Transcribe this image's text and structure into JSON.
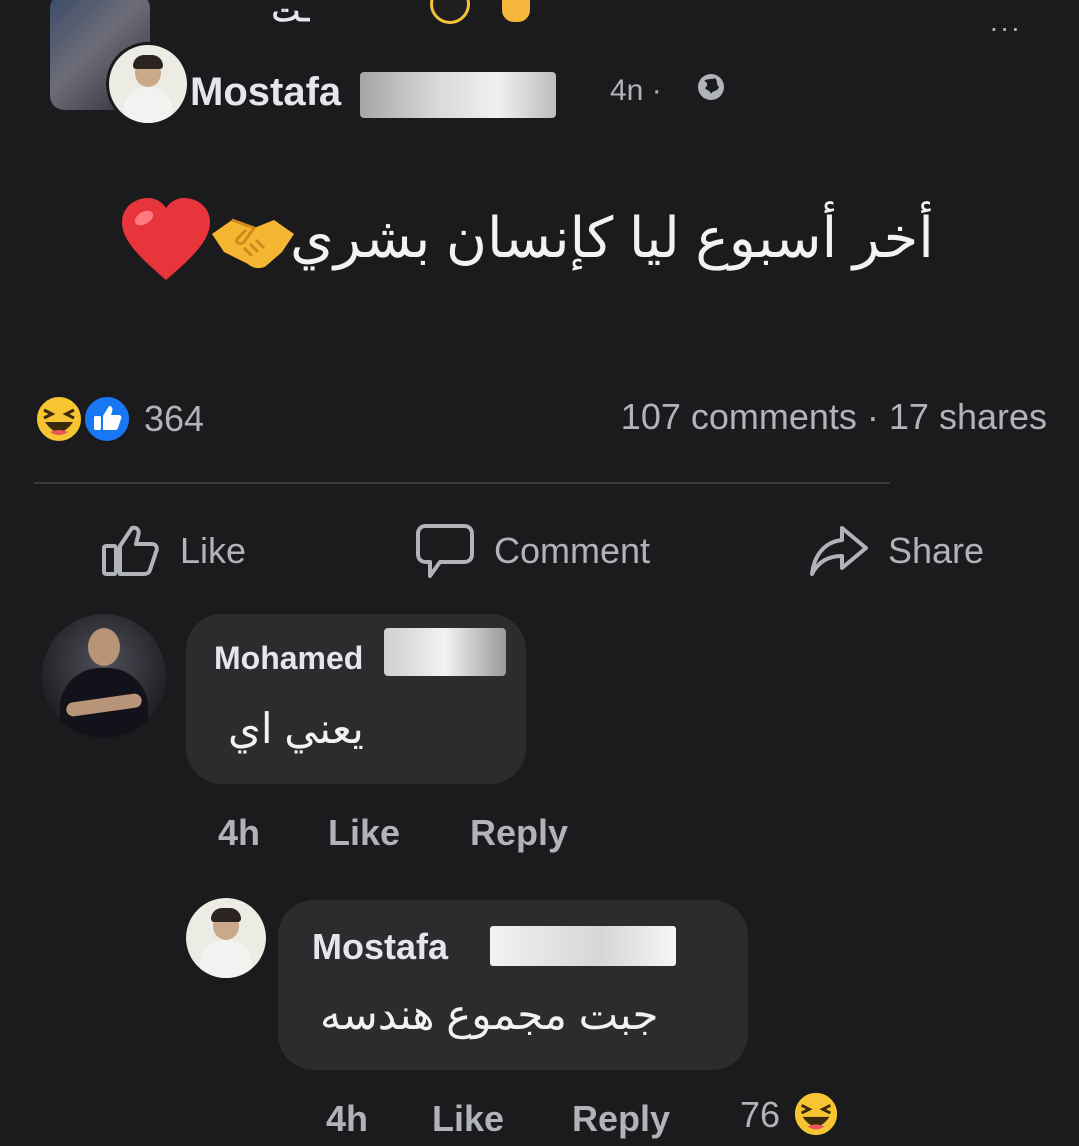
{
  "post": {
    "group_name_fragment": "ـت",
    "author": "Mostafa",
    "time": "4n ·",
    "text": "أخر أسبوع ليا كإنسان بشري",
    "reaction_count": "364",
    "comments_shares": "107 comments · 17 shares",
    "more_menu": "..."
  },
  "actions": {
    "like": "Like",
    "comment": "Comment",
    "share": "Share"
  },
  "comments": [
    {
      "author": "Mohamed",
      "text": "يعني اي",
      "time": "4h",
      "like": "Like",
      "reply": "Reply"
    },
    {
      "author": "Mostafa",
      "text": "جبت مجموع هندسه",
      "time": "4h",
      "like": "Like",
      "reply": "Reply",
      "reaction_count": "76"
    }
  ],
  "icons": [
    "more-icon",
    "globe-icon",
    "handshake-icon",
    "heart-icon",
    "haha-icon",
    "like-reaction-icon",
    "thumbs-up-icon",
    "comment-icon",
    "share-icon"
  ],
  "colors": {
    "background": "#1b1b1d",
    "bubble": "#2c2c2f",
    "text": "#e4e6eb",
    "muted": "#b0b3b8",
    "like_blue": "#1877f2",
    "emoji_yellow": "#f7c531",
    "heart_red": "#e8353b"
  }
}
